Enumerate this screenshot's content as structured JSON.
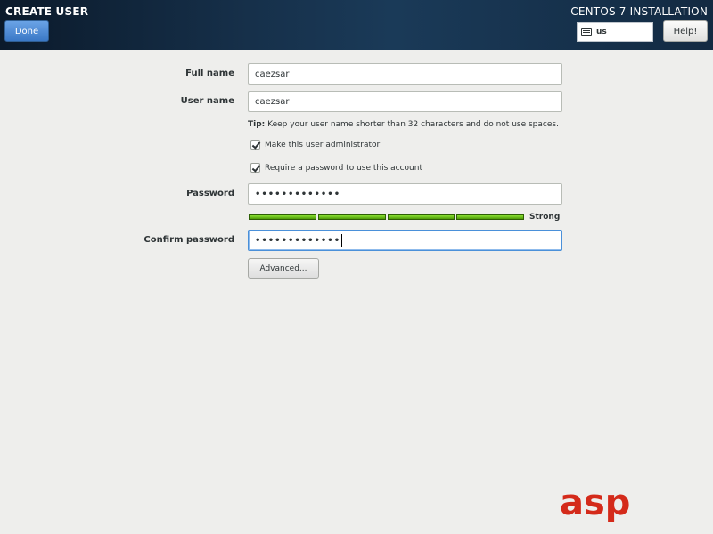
{
  "header": {
    "spoke_title": "CREATE USER",
    "done_label": "Done",
    "installer_title": "CENTOS 7 INSTALLATION",
    "keyboard_layout": "us",
    "help_label": "Help!"
  },
  "form": {
    "full_name": {
      "label": "Full name",
      "value": "caezsar"
    },
    "user_name": {
      "label": "User name",
      "value": "caezsar"
    },
    "tip": {
      "prefix": "Tip:",
      "text": "Keep your user name shorter than 32 characters and do not use spaces."
    },
    "admin_checkbox": {
      "label": "Make this user administrator",
      "checked": true
    },
    "require_password_checkbox": {
      "label": "Require a password to use this account",
      "checked": true
    },
    "password": {
      "label": "Password",
      "masked": "•••••••••••••"
    },
    "strength": {
      "label": "Strength",
      "value_label": "Strong",
      "level_fraction": 1.0,
      "color": "#4e9a06"
    },
    "confirm_password": {
      "label": "Confirm password",
      "masked": "•••••••••••••"
    },
    "advanced_label": "Advanced..."
  },
  "icons": {
    "keyboard": "keyboard-icon",
    "checkmark": "checkmark-icon"
  },
  "watermark": {
    "text": "asp"
  },
  "colors": {
    "header_bg": "#132a42",
    "accent": "#4a90d9",
    "page_bg": "#eeeeec"
  }
}
